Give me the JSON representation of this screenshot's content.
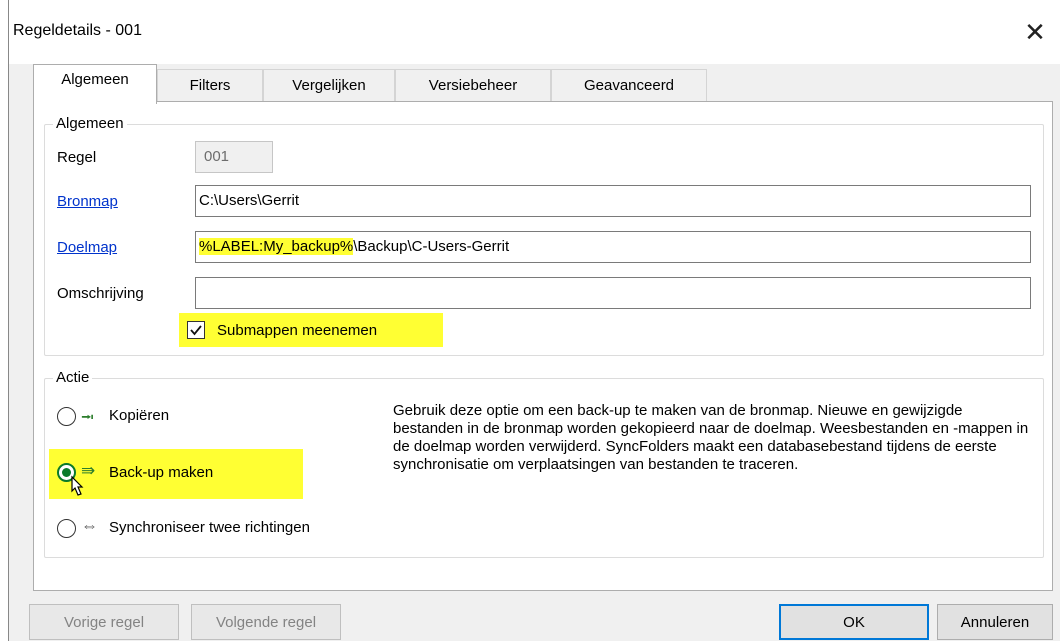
{
  "window": {
    "title": "Regeldetails - 001",
    "close_glyph": "✕"
  },
  "tabs": [
    {
      "label": "Algemeen",
      "active": true
    },
    {
      "label": "Filters",
      "active": false
    },
    {
      "label": "Vergelijken",
      "active": false
    },
    {
      "label": "Versiebeheer",
      "active": false
    },
    {
      "label": "Geavanceerd",
      "active": false
    }
  ],
  "general": {
    "group_label": "Algemeen",
    "rule_label": "Regel",
    "rule_value": "001",
    "source_label": "Bronmap",
    "source_value": "C:\\Users\\Gerrit",
    "target_label": "Doelmap",
    "target_value_highlight": "%LABEL:My_backup%",
    "target_value_rest": "\\Backup\\C-Users-Gerrit",
    "description_label": "Omschrijving",
    "description_value": "",
    "include_subfolders_label": "Submappen meenemen",
    "include_subfolders_checked": true
  },
  "action": {
    "group_label": "Actie",
    "options": [
      {
        "label": "Kopiëren",
        "icon": "copy-arrow-icon",
        "glyph": "⭲",
        "checked": false
      },
      {
        "label": "Back-up maken",
        "icon": "backup-arrow-icon",
        "glyph": "⇛",
        "checked": true
      },
      {
        "label": "Synchroniseer twee richtingen",
        "icon": "two-way-arrow-icon",
        "glyph": "⇔",
        "checked": false
      }
    ],
    "description": "Gebruik deze optie om een back-up te maken van de bronmap. Nieuwe en gewijzigde bestanden in de bronmap worden gekopieerd naar de doelmap. Weesbestanden en -mappen in de doelmap worden verwijderd. SyncFolders maakt een databasebestand tijdens de eerste synchronisatie om verplaatsingen van bestanden te traceren."
  },
  "buttons": {
    "prev": "Vorige regel",
    "next": "Volgende regel",
    "ok": "OK",
    "cancel": "Annuleren"
  },
  "colors": {
    "highlight": "#ffff33",
    "link": "#0033cc",
    "accent": "#0078d7",
    "radio_checked": "#0a7a2a"
  }
}
